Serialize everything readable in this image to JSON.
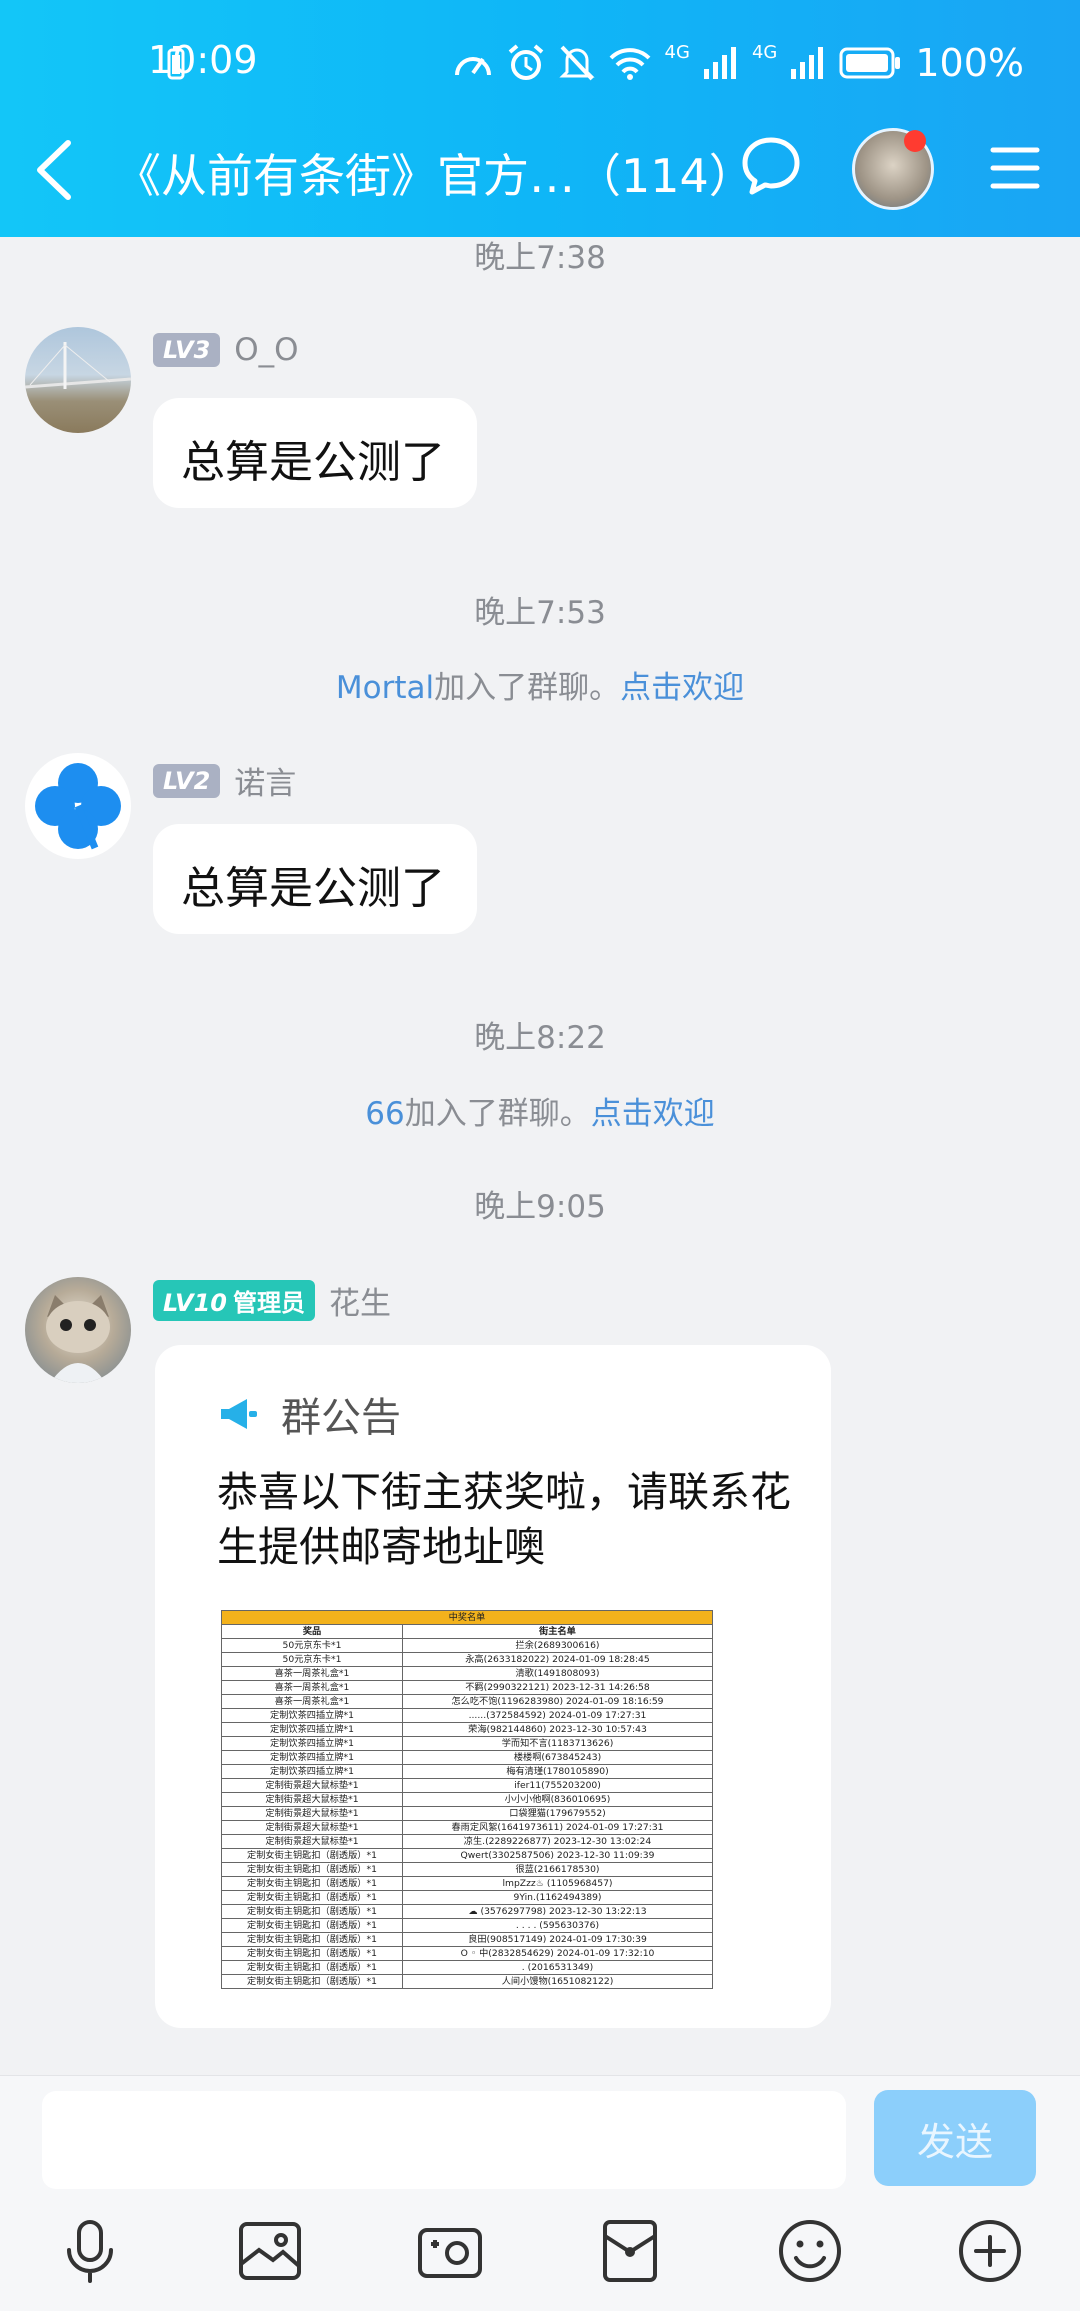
{
  "status_bar": {
    "time": "10:09",
    "network_1": "4G",
    "network_2": "4G",
    "battery": "100%"
  },
  "header": {
    "title": "《从前有条街》官方…（114）",
    "icons": [
      "back-arrow-icon",
      "chat-bubble-icon",
      "group-avatar",
      "menu-icon"
    ]
  },
  "messages": [
    {
      "type": "time",
      "text": "晚上7:38"
    },
    {
      "type": "chat",
      "level": "LV3",
      "name": "O_O",
      "text": "总算是公测了"
    },
    {
      "type": "time",
      "text": "晚上7:53"
    },
    {
      "type": "system",
      "user": "Mortal",
      "text": "加入了群聊。",
      "link": "点击欢迎"
    },
    {
      "type": "chat",
      "level": "LV2",
      "name": "诺言",
      "text": "总算是公测了"
    },
    {
      "type": "time",
      "text": "晚上8:22"
    },
    {
      "type": "system",
      "user": "66",
      "text": "加入了群聊。",
      "link": "点击欢迎"
    },
    {
      "type": "time",
      "text": "晚上9:05"
    },
    {
      "type": "notice",
      "level": "LV10",
      "role": "管理员",
      "name": "花生",
      "notice_title": "群公告",
      "notice_body": "恭喜以下街主获奖啦，请联系花生提供邮寄地址噢"
    }
  ],
  "prize_table": {
    "caption": "中奖名单",
    "headers": [
      "奖品",
      "街主名单"
    ],
    "rows": [
      [
        "50元京东卡*1",
        "拦余(2689300616)"
      ],
      [
        "50元京东卡*1",
        "永高(2633182022) 2024-01-09 18:28:45"
      ],
      [
        "喜茶一周茶礼盒*1",
        "清歌(1491808093)"
      ],
      [
        "喜茶一周茶礼盒*1",
        "不羁(2990322121) 2023-12-31 14:26:58"
      ],
      [
        "喜茶一周茶礼盒*1",
        "怎么吃不饱(1196283980) 2024-01-09 18:16:59"
      ],
      [
        "定制饮茶四插立牌*1",
        "......(372584592) 2024-01-09 17:27:31"
      ],
      [
        "定制饮茶四插立牌*1",
        "荣海(982144860) 2023-12-30 10:57:43"
      ],
      [
        "定制饮茶四插立牌*1",
        "学而知不言(1183713626)"
      ],
      [
        "定制饮茶四插立牌*1",
        "楼楼啊(673845243)"
      ],
      [
        "定制饮茶四插立牌*1",
        "梅有清瑾(1780105890)"
      ],
      [
        "定制街景超大鼠标垫*1",
        "ifer11(755203200)"
      ],
      [
        "定制街景超大鼠标垫*1",
        "小小小他啊(836010695)"
      ],
      [
        "定制街景超大鼠标垫*1",
        "口袋狸猫(179679552)"
      ],
      [
        "定制街景超大鼠标垫*1",
        "春雨定风絮(1641973611) 2024-01-09 17:27:31"
      ],
      [
        "定制街景超大鼠标垫*1",
        "凉生.(2289226877) 2023-12-30 13:02:24"
      ],
      [
        "定制女街主钥匙扣（剧透版）*1",
        "Qwert(3302587506) 2023-12-30 11:09:39"
      ],
      [
        "定制女街主钥匙扣（剧透版）*1",
        "很蓝(2166178530)"
      ],
      [
        "定制女街主钥匙扣（剧透版）*1",
        "lmpZzz♨ (1105968457)"
      ],
      [
        "定制女街主钥匙扣（剧透版）*1",
        "9Yin.(1162494389)"
      ],
      [
        "定制女街主钥匙扣（剧透版）*1",
        "☁ (3576297798) 2023-12-30 13:22:13"
      ],
      [
        "定制女街主钥匙扣（剧透版）*1",
        ". . . . (595630376)"
      ],
      [
        "定制女街主钥匙扣（剧透版）*1",
        "良田(908517149) 2024-01-09 17:30:39"
      ],
      [
        "定制女街主钥匙扣（剧透版）*1",
        "O ◦ 中(2832854629) 2024-01-09 17:32:10"
      ],
      [
        "定制女街主钥匙扣（剧透版）*1",
        ". (2016531349)"
      ],
      [
        "定制女街主钥匙扣（剧透版）*1",
        "人间小馒物(1651082122)"
      ]
    ]
  },
  "input": {
    "value": "",
    "placeholder": "",
    "send_label": "发送"
  },
  "toolbar": [
    "microphone-icon",
    "image-icon",
    "camera-icon",
    "red-packet-icon",
    "emoji-icon",
    "plus-icon"
  ],
  "colors": {
    "header": "#13c6f8",
    "link": "#4a90d9",
    "admin_badge": "#26c6b7",
    "send_button": "#8ccffb"
  }
}
